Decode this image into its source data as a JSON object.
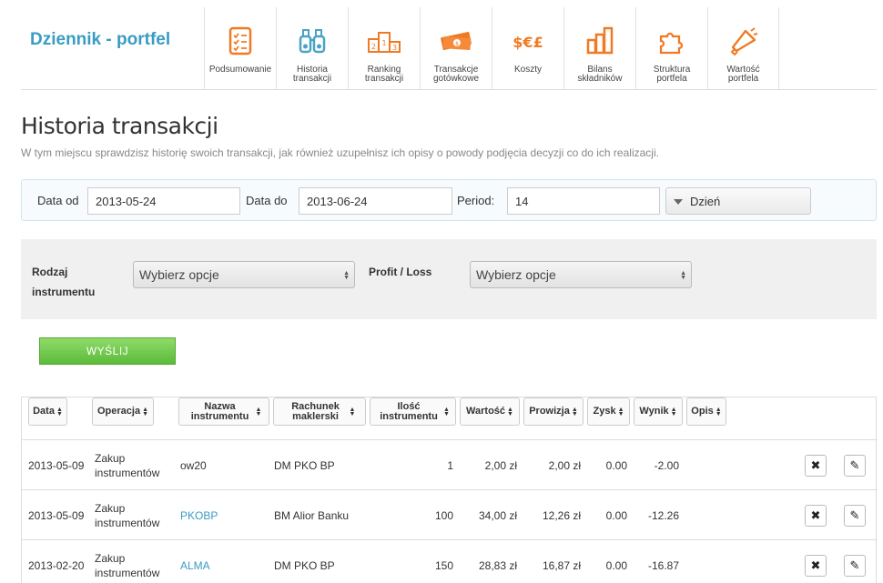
{
  "header": {
    "brand": "Dziennik - portfel",
    "nav": [
      {
        "label": "Podsumowanie",
        "icon": "checklist-icon"
      },
      {
        "label": "Historia\ntransakcji",
        "icon": "binoculars-icon"
      },
      {
        "label": "Ranking\ntransakcji",
        "icon": "podium-icon"
      },
      {
        "label": "Transakcje\ngotówkowe",
        "icon": "cash-icon"
      },
      {
        "label": "Koszty",
        "icon": "currency-icon"
      },
      {
        "label": "Bilans\nskładników",
        "icon": "bar-chart-icon"
      },
      {
        "label": "Struktura\nportfela",
        "icon": "puzzle-icon"
      },
      {
        "label": "Wartość\nportfela",
        "icon": "megaphone-icon"
      }
    ],
    "accent_color": "#f07a23"
  },
  "page": {
    "title": "Historia transakcji",
    "description": "W tym miejscu sprawdzisz historię swoich transakcji, jak również uzupełnisz ich opisy o powody podjęcia decyzji co do ich realizacji."
  },
  "dates": {
    "from_label": "Data od",
    "from_value": "2013-05-24",
    "to_label": "Data do",
    "to_value": "2013-06-24",
    "period_label": "Period:",
    "period_value": "14",
    "unit_value": "Dzień"
  },
  "filters": {
    "instrument_type_label": "Rodzaj instrumentu",
    "instrument_type_value": "Wybierz opcje",
    "profit_loss_label": "Profit / Loss",
    "profit_loss_value": "Wybierz opcje",
    "submit_label": "WYŚLIJ"
  },
  "table": {
    "columns": [
      "Data",
      "Operacja",
      "Nazwa instrumentu",
      "Rachunek maklerski",
      "Ilość instrumentu",
      "Wartość",
      "Prowizja",
      "Zysk",
      "Wynik",
      "Opis"
    ],
    "rows": [
      {
        "date": "2013-05-09",
        "operation": "Zakup instrumentów",
        "name": "ow20",
        "link": false,
        "account": "DM PKO BP",
        "qty": "1",
        "value": "2,00 zł",
        "commission": "2,00 zł",
        "profit": "0.00",
        "result": "-2.00"
      },
      {
        "date": "2013-05-09",
        "operation": "Zakup instrumentów",
        "name": "PKOBP",
        "link": true,
        "account": "BM Alior Banku",
        "qty": "100",
        "value": "34,00 zł",
        "commission": "12,26 zł",
        "profit": "0.00",
        "result": "-12.26"
      },
      {
        "date": "2013-02-20",
        "operation": "Zakup instrumentów",
        "name": "ALMA",
        "link": true,
        "account": "DM PKO BP",
        "qty": "150",
        "value": "28,83 zł",
        "commission": "16,87 zł",
        "profit": "0.00",
        "result": "-16.87"
      }
    ]
  }
}
